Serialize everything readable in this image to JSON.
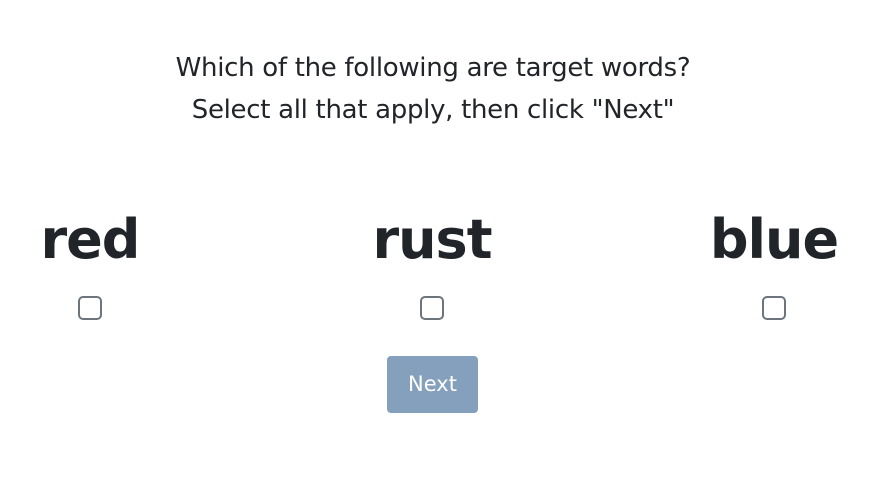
{
  "prompt": {
    "line1": "Which of the following are target words?",
    "line2": "Select all that apply, then click \"Next\""
  },
  "options": [
    {
      "word": "red",
      "checked": false
    },
    {
      "word": "rust",
      "checked": false
    },
    {
      "word": "blue",
      "checked": false
    }
  ],
  "next_button": {
    "label": "Next",
    "disabled": true
  },
  "colors": {
    "text": "#212529",
    "checkbox_border": "#6c757d",
    "button_bg": "#84a0bc",
    "button_text": "#ffffff"
  }
}
